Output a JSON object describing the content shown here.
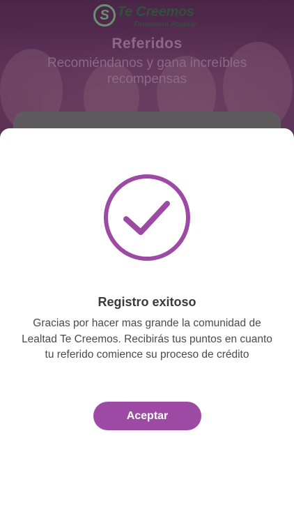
{
  "header": {
    "logo_mark": "S",
    "logo_text": "Te Creemos",
    "logo_subtext": "Financiera Popular",
    "title": "Referidos",
    "subtitle": "Recomiéndanos y gana increíbles recompensas"
  },
  "modal": {
    "icon": "checkmark-circle-icon",
    "title": "Registro exitoso",
    "message": "Gracias por hacer mas grande la comunidad de Lealtad Te Creemos. Recibirás tus puntos en cuanto tu referido comience su proceso de crédito",
    "accept_label": "Aceptar"
  },
  "colors": {
    "accent": "#9d4aa4",
    "hero_overlay": "#4e2a4c",
    "logo_green": "#33503e"
  }
}
